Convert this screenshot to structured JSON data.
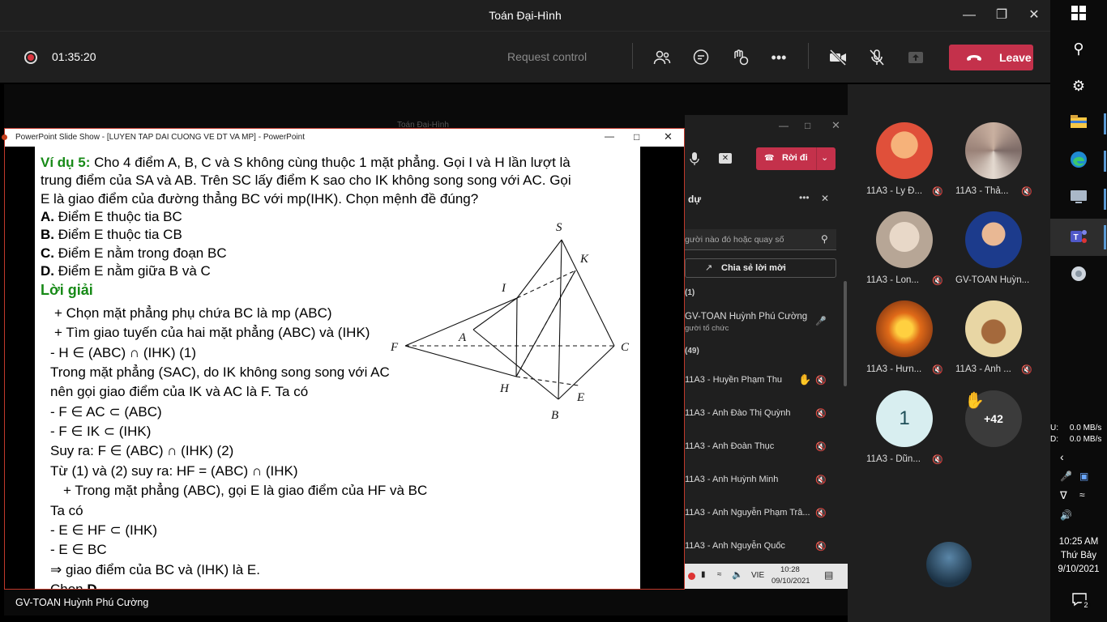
{
  "window": {
    "title": "Toán Đại-Hình"
  },
  "toolbar": {
    "timer": "01:35:20",
    "request_control": "Request control",
    "leave_label": "Leave"
  },
  "shared": {
    "ghost_title": "Toán Đại-Hình",
    "leave_label": "Rời đi",
    "panel_title": "dự",
    "search_placeholder": "gười nào đó hoặc quay số",
    "share_invite": "Chia sẻ lời mời",
    "section1": "(1)",
    "organizer_name": "GV-TOAN Huỳnh Phú Cường",
    "organizer_role": "gười tổ chức",
    "section2": "(49)",
    "people": [
      "11A3 - Huyền Phạm Thu",
      "11A3 - Anh Đào Thị Quỳnh",
      "11A3 - Anh Đoàn Thục",
      "11A3 - Anh Huỳnh Minh",
      "11A3 - Anh Nguyễn Phạm Trâ...",
      "11A3 - Anh Nguyễn Quốc"
    ],
    "tray_lang": "VIE",
    "tray_time": "10:28",
    "tray_date": "09/10/2021"
  },
  "ppt": {
    "title": "PowerPoint Slide Show - [LUYEN TAP DAI CUONG VE DT VA MP] - PowerPoint"
  },
  "slide": {
    "ex_label": "Ví dụ 5:",
    "ex_line1": " Cho 4 điểm A, B, C và S không cùng thuộc 1 mặt phẳng. Gọi I và H lần lượt là",
    "ex_line2": "trung điểm của SA và AB. Trên SC lấy điểm K sao cho IK không song song với AC. Gọi",
    "ex_line3": "E là giao điểm của đường thẳng BC với mp(IHK). Chọn mệnh đề đúng?",
    "opt_a_key": "A.",
    "opt_a": " Điểm E thuộc tia BC",
    "opt_b_key": "B.",
    "opt_b": " Điểm E thuộc tia CB",
    "opt_c_key": "C.",
    "opt_c": " Điểm E nằm trong đoạn BC",
    "opt_d_key": "D.",
    "opt_d": " Điểm E nằm giữa B và C",
    "solution": "Lời giải",
    "s1": "+ Chọn mặt phẳng phụ chứa BC là mp (ABC)",
    "s2": "+ Tìm giao tuyến của hai mặt phẳng (ABC) và (IHK)",
    "s3": "- H ∈ (ABC) ∩ (IHK)    (1)",
    "s4": "Trong mặt phẳng (SAC), do IK không song song với AC",
    "s5": "nên gọi giao điểm của IK và AC là F. Ta có",
    "s6": "- F ∈ AC ⊂ (ABC)",
    "s7": "- F ∈ IK ⊂ (IHK)",
    "s8": "Suy ra: F ∈ (ABC) ∩ (IHK)    (2)",
    "s9": "Từ (1) và (2) suy ra: HF = (ABC) ∩ (IHK)",
    "s10": "+ Trong mặt phẳng (ABC), gọi E là giao điểm của HF và BC",
    "s11": "Ta có",
    "s12": "- E ∈ HF ⊂ (IHK)",
    "s13": "- E ∈ BC",
    "s14": "⇒ giao điểm của BC và (IHK) là E.",
    "s15_pre": "Chọn ",
    "s15_ans": "D",
    "fig": {
      "S": "S",
      "K": "K",
      "I": "I",
      "A": "A",
      "F": "F",
      "C": "C",
      "H": "H",
      "E": "E",
      "B": "B"
    }
  },
  "presenter": "GV-TOAN Huỳnh Phú Cường",
  "roster": {
    "participants": [
      {
        "name": "11A3 - Ly Đ..."
      },
      {
        "name": "11A3 - Thả..."
      },
      {
        "name": "11A3 - Lon..."
      },
      {
        "name": "GV-TOAN Huỳn..."
      },
      {
        "name": "11A3 - Hưn..."
      },
      {
        "name": "11A3 - Anh ..."
      },
      {
        "name": "11A3 - Dũn...",
        "initial": "1"
      }
    ],
    "more_count": "+42"
  },
  "taskbar": {
    "net_up": "U:     0.0 MB/s",
    "net_down": "D:     0.0 MB/s",
    "time": "10:25 AM",
    "day": "Thứ Bảy",
    "date": "9/10/2021",
    "notif_count": "2"
  }
}
